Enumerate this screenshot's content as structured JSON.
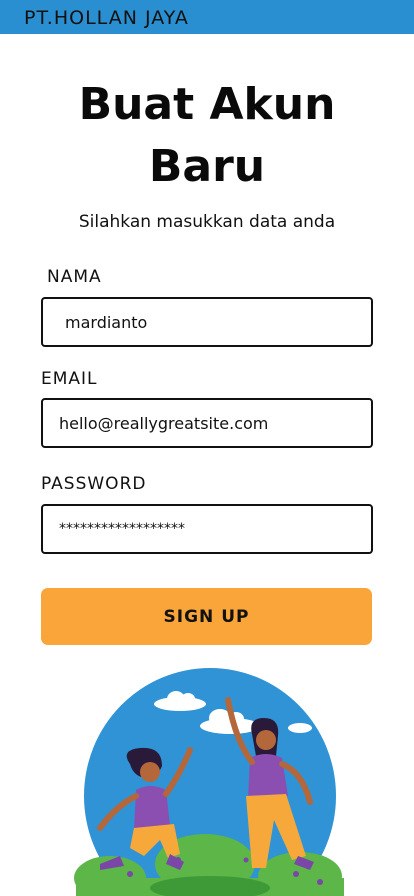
{
  "header": {
    "company": "PT.HOLLAN JAYA",
    "bar_color": "#2a8fd1"
  },
  "form": {
    "title_line1": "Buat Akun",
    "title_line2": "Baru",
    "subtitle": "Silahkan masukkan data anda",
    "name": {
      "label": "NAMA",
      "value": "mardianto"
    },
    "email": {
      "label": "EMAIL",
      "value": "hello@reallygreatsite.com"
    },
    "password": {
      "label": "PASSWORD",
      "value": "******************"
    },
    "submit_label": "SIGN UP",
    "submit_color": "#f9a539"
  },
  "illustration": {
    "icon": "two-women-jumping-illustration"
  }
}
